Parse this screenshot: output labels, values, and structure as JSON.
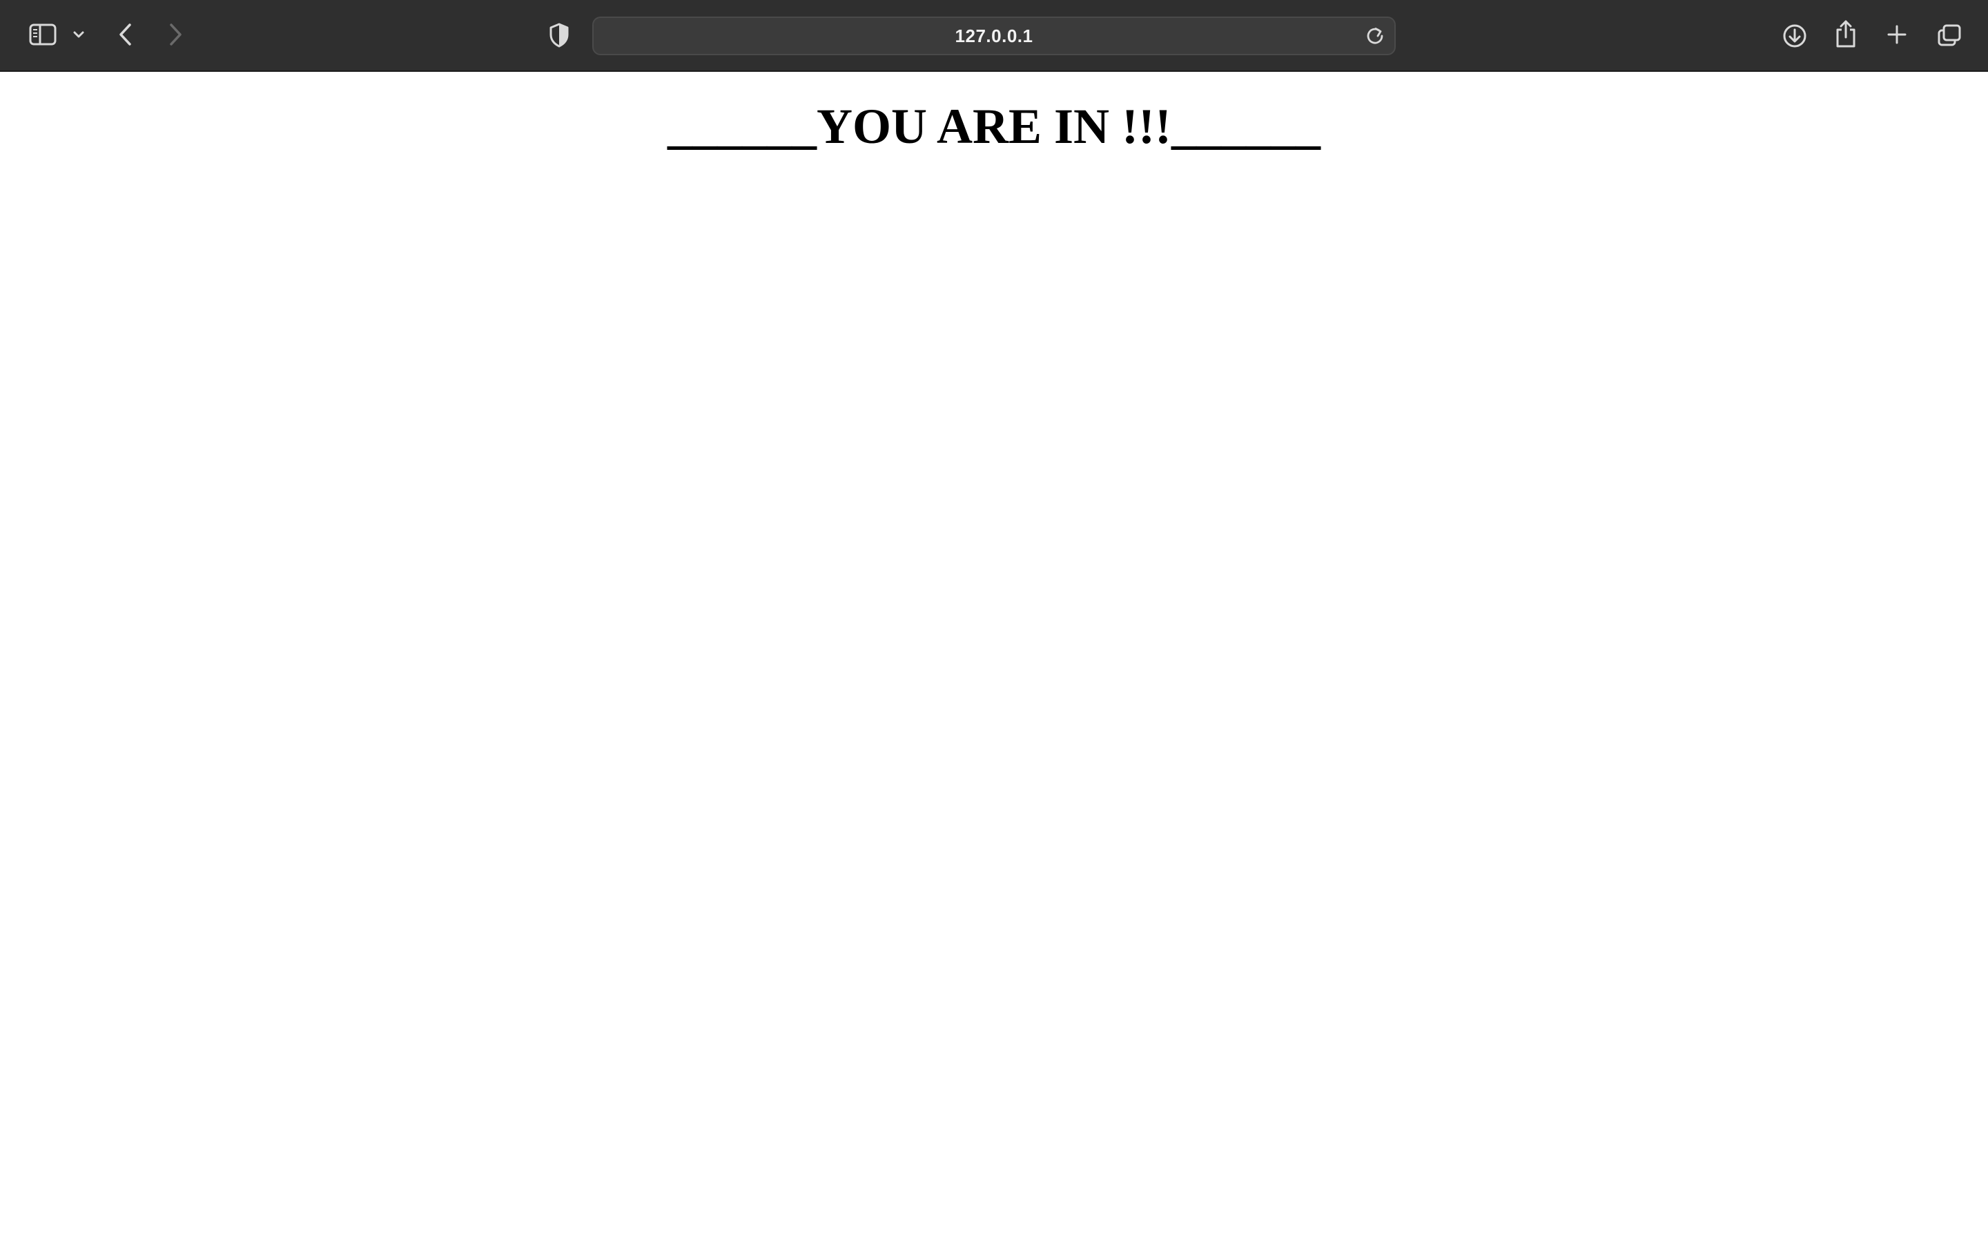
{
  "browser": {
    "address": "127.0.0.1",
    "icons": {
      "sidebar": "sidebar-icon",
      "sidebar_menu": "chevron-down-icon",
      "back": "chevron-left-icon",
      "forward": "chevron-right-icon",
      "privacy": "shield-icon",
      "reload": "reload-icon",
      "downloads": "download-icon",
      "share": "share-icon",
      "new_tab": "plus-icon",
      "tab_overview": "tabs-icon"
    },
    "colors": {
      "toolbar_bg": "#2f2f2f",
      "address_bg": "#3b3b3b",
      "icon": "#d9d9d9",
      "icon_disabled": "#6a6a6a"
    }
  },
  "page": {
    "headline": "______YOU ARE IN !!!______",
    "background": "#ffffff"
  }
}
